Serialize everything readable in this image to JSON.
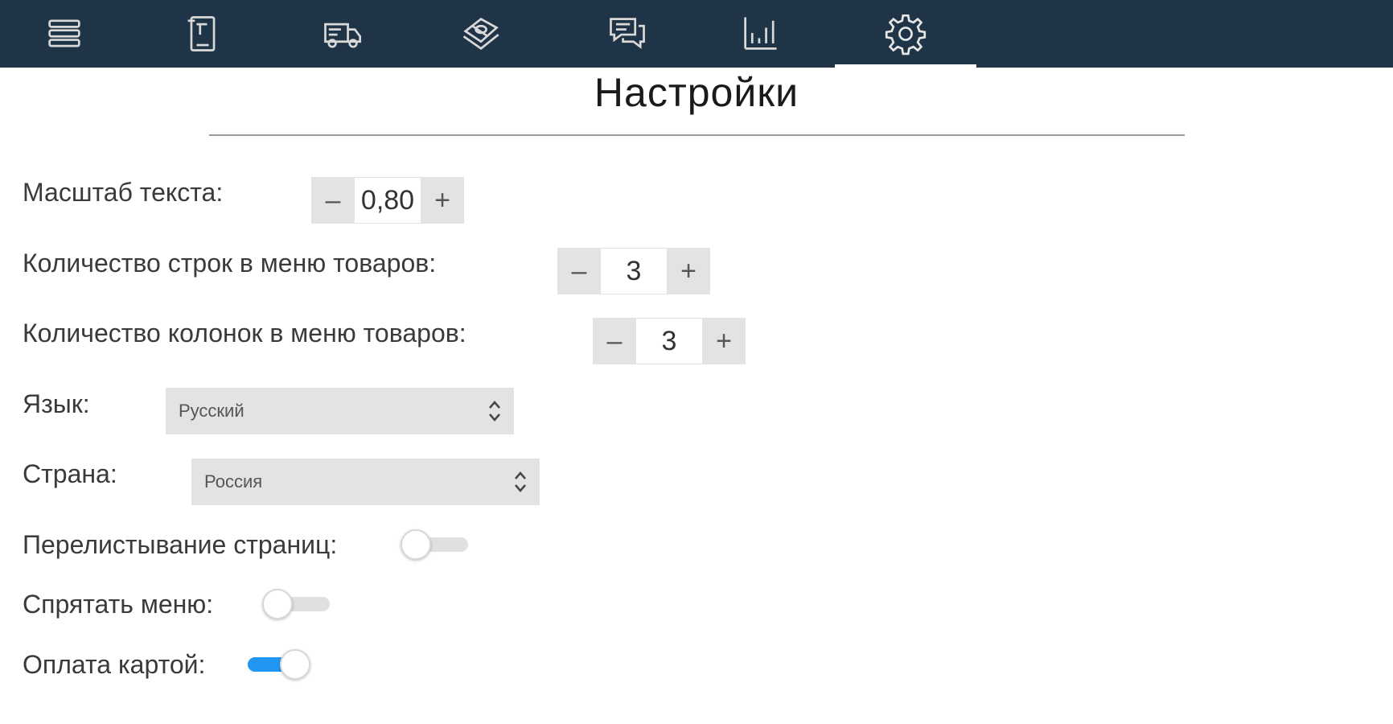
{
  "page": {
    "title": "Настройки"
  },
  "nav": {
    "items": [
      {
        "icon": "menu-icon"
      },
      {
        "icon": "receipt-icon"
      },
      {
        "icon": "delivery-truck-icon"
      },
      {
        "icon": "money-icon"
      },
      {
        "icon": "chat-icon"
      },
      {
        "icon": "chart-icon"
      },
      {
        "icon": "gear-icon",
        "active": true
      }
    ]
  },
  "settings": {
    "text_scale": {
      "label": "Масштаб текста:",
      "value": "0,80",
      "minus": "–",
      "plus": "+"
    },
    "menu_rows": {
      "label": "Количество строк в меню товаров:",
      "value": "3",
      "minus": "–",
      "plus": "+"
    },
    "menu_cols": {
      "label": "Количество колонок в меню товаров:",
      "value": "3",
      "minus": "–",
      "plus": "+"
    },
    "language": {
      "label": "Язык:",
      "value": "Русский"
    },
    "country": {
      "label": "Страна:",
      "value": "Россия"
    },
    "page_flip": {
      "label": "Перелистывание страниц:",
      "enabled": false
    },
    "hide_menu": {
      "label": "Спрятать меню:",
      "enabled": false
    },
    "card_payment": {
      "label": "Оплата картой:",
      "enabled": true
    }
  },
  "colors": {
    "topbar": "#1f3446",
    "toggle_on": "#2196f3"
  }
}
